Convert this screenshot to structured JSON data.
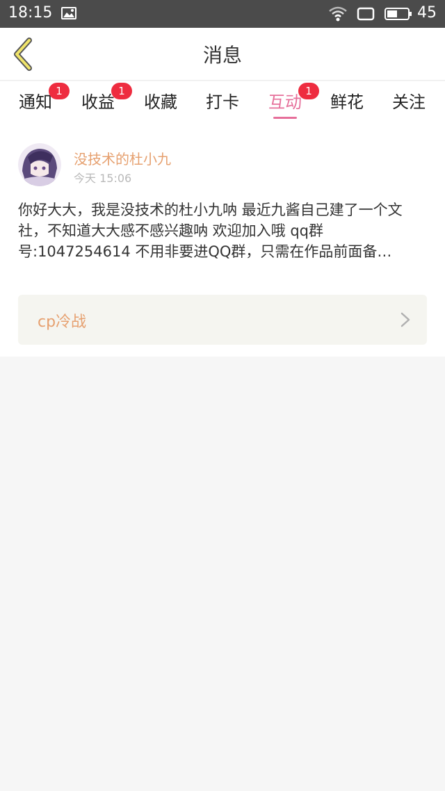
{
  "status_bar": {
    "time": "18:15",
    "battery_level": "45"
  },
  "header": {
    "title": "消息"
  },
  "tabs": [
    {
      "label": "通知",
      "badge": "1"
    },
    {
      "label": "收益",
      "badge": "1"
    },
    {
      "label": "收藏",
      "badge": ""
    },
    {
      "label": "打卡",
      "badge": ""
    },
    {
      "label": "互动",
      "badge": "1",
      "active": true
    },
    {
      "label": "鲜花",
      "badge": ""
    },
    {
      "label": "关注",
      "badge": ""
    }
  ],
  "message": {
    "author": "没技术的杜小九",
    "time": "今天 15:06",
    "body": "你好大大，我是没技术的杜小九呐 最近九酱自己建了一个文社，不知道大大感不感兴趣呐 欢迎加入哦 qq群号:1047254614 不用非要进QQ群，只需在作品前面备…",
    "linked_post": "cp冷战"
  },
  "colors": {
    "accent": "#e66f9a",
    "author": "#e6a06f",
    "badge": "#ee2c3f",
    "status_bar": "#4b4b4b"
  }
}
